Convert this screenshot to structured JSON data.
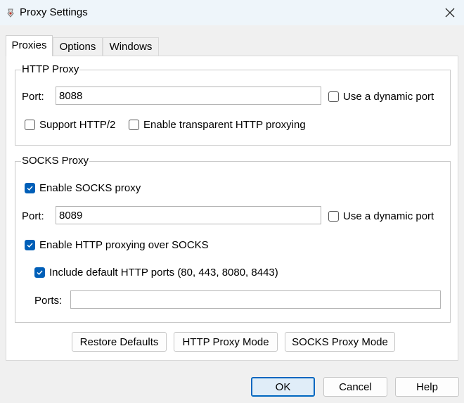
{
  "window": {
    "title": "Proxy Settings",
    "app_icon": "proxy-app-icon",
    "close_icon": "close-icon"
  },
  "tabs": [
    {
      "label": "Proxies",
      "active": true
    },
    {
      "label": "Options",
      "active": false
    },
    {
      "label": "Windows",
      "active": false
    }
  ],
  "http_proxy": {
    "group_title": "HTTP Proxy",
    "port_label": "Port:",
    "port_value": "8088",
    "dynamic_port_label": "Use a dynamic port",
    "dynamic_port_checked": false,
    "http2_label": "Support HTTP/2",
    "http2_checked": false,
    "transparent_label": "Enable transparent HTTP proxying",
    "transparent_checked": false
  },
  "socks_proxy": {
    "group_title": "SOCKS Proxy",
    "enable_label": "Enable SOCKS proxy",
    "enable_checked": true,
    "port_label": "Port:",
    "port_value": "8089",
    "dynamic_port_label": "Use a dynamic port",
    "dynamic_port_checked": false,
    "http_over_socks_label": "Enable HTTP proxying over SOCKS",
    "http_over_socks_checked": true,
    "default_ports_label": "Include default HTTP ports (80, 443, 8080, 8443)",
    "default_ports_checked": true,
    "ports_label": "Ports:",
    "ports_value": ""
  },
  "panel_buttons": {
    "restore": "Restore Defaults",
    "http_mode": "HTTP Proxy Mode",
    "socks_mode": "SOCKS Proxy Mode"
  },
  "dialog_buttons": {
    "ok": "OK",
    "cancel": "Cancel",
    "help": "Help"
  },
  "colors": {
    "accent": "#005fb8",
    "titlebar": "#eef5fa",
    "panel": "#ffffff",
    "window": "#f0f0f0"
  }
}
